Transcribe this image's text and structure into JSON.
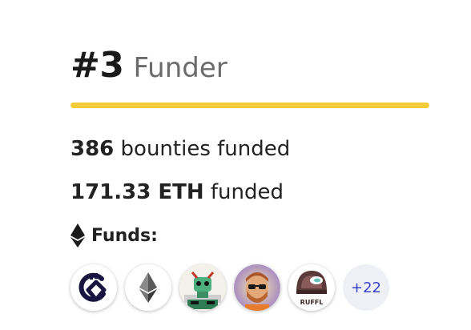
{
  "funder": {
    "rank": "#3",
    "role_label": "Funder"
  },
  "stats": {
    "bounties_count": "386",
    "bounties_label": "bounties funded",
    "eth_amount": "171.33 ETH",
    "eth_label": "funded"
  },
  "funds": {
    "label": "Funds:",
    "icon": "ethereum-icon",
    "tokens": [
      {
        "name": "token-avatar-1",
        "icon": "circular-c-logo"
      },
      {
        "name": "token-avatar-ethereum",
        "icon": "ethereum-icon"
      },
      {
        "name": "token-avatar-robot",
        "icon": "robot-character"
      },
      {
        "name": "token-avatar-man",
        "icon": "man-with-sunglasses"
      },
      {
        "name": "token-avatar-cake",
        "icon": "truffle-logo"
      }
    ],
    "more_count": "+22"
  },
  "colors": {
    "accent_underline": "#f4cc3a",
    "more_text": "#3a3fcf"
  }
}
